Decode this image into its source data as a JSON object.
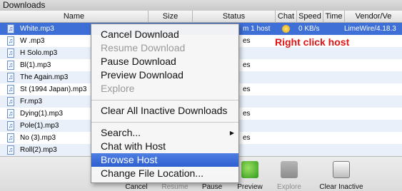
{
  "window": {
    "title": "Downloads"
  },
  "columns": [
    {
      "label": "Name"
    },
    {
      "label": "Size"
    },
    {
      "label": "Status"
    },
    {
      "label": "Chat"
    },
    {
      "label": "Speed"
    },
    {
      "label": "Time"
    },
    {
      "label": "Vendor/Ve"
    }
  ],
  "rows": [
    {
      "name": "White.mp3",
      "status": "m 1 host",
      "speed": "0 KB/s",
      "vendor": "LimeWire/4.18.3"
    },
    {
      "name": "W .mp3",
      "status": "es"
    },
    {
      "name": "H Solo.mp3",
      "status": ""
    },
    {
      "name": "Bl(1).mp3",
      "status": "es"
    },
    {
      "name": "The Again.mp3",
      "status": ""
    },
    {
      "name": "St (1994  Japan).mp3",
      "status": "es"
    },
    {
      "name": "Fr.mp3",
      "status": ""
    },
    {
      "name": "Dying(1).mp3",
      "status": "es"
    },
    {
      "name": "Pole(1).mp3",
      "status": ""
    },
    {
      "name": "No (3).mp3",
      "status": "es"
    },
    {
      "name": "Roll(2).mp3",
      "status": ""
    }
  ],
  "annotation": "Right click host",
  "context_menu": {
    "items": [
      {
        "label": "Cancel Download"
      },
      {
        "label": "Resume Download"
      },
      {
        "label": "Pause Download"
      },
      {
        "label": "Preview Download"
      },
      {
        "label": "Explore"
      },
      {
        "label": "Clear All Inactive Downloads"
      },
      {
        "label": "Search..."
      },
      {
        "label": "Chat with Host"
      },
      {
        "label": "Browse Host"
      },
      {
        "label": "Change File Location..."
      }
    ]
  },
  "toolbar": {
    "cancel": "Cancel",
    "resume": "Resume",
    "pause": "Pause",
    "preview": "Preview",
    "explore": "Explore",
    "clear_inactive": "Clear Inactive"
  },
  "colors": {
    "selection": "#3d6fd6",
    "annotation": "#e01414",
    "menu_highlight": "#2e5fd0"
  }
}
